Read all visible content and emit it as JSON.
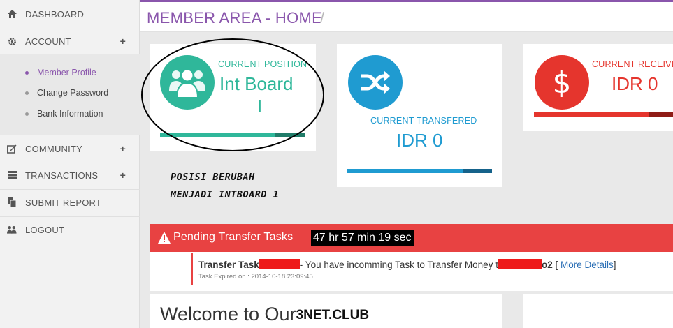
{
  "sidebar": {
    "dashboard": "DASHBOARD",
    "account": "ACCOUNT",
    "account_sub": [
      "Member Profile",
      "Change Password",
      "Bank Information"
    ],
    "community": "COMMUNITY",
    "transactions": "TRANSACTIONS",
    "submit_report": "SUBMIT REPORT",
    "logout": "LOGOUT",
    "plus": "+"
  },
  "header": {
    "title": "MEMBER AREA - HOME",
    "separator": "/"
  },
  "cards": {
    "position": {
      "label": "CURRENT POSITION",
      "value": "Int Board",
      "value_line2": "I",
      "color": "#2fb79a",
      "icon": "users-icon"
    },
    "transfered": {
      "label": "CURRENT TRANSFERED",
      "value": "IDR 0",
      "color": "#1f9bd1",
      "icon": "shuffle-icon"
    },
    "received": {
      "label": "CURRENT RECEIVED",
      "value": "IDR 0",
      "color": "#e5352d",
      "icon": "dollar-icon"
    }
  },
  "annotation": {
    "line1": "POSISI BERUBAH",
    "line2": "MENJADI INTBOARD 1"
  },
  "pending": {
    "title": "Pending Transfer Tasks",
    "timer": "47 hr 57 min 19 sec",
    "task": {
      "prefix": "Transfer Task",
      "mid": "- You have incomming Task to Transfer Money t",
      "suffix": "o2",
      "link_open": "[",
      "link": "More Details",
      "link_close": "]",
      "expired": "Task Expired on : 2014-10-18 23:09:45"
    }
  },
  "welcome": {
    "text": "Welcome to Our",
    "brand": "3NET.CLUB"
  }
}
